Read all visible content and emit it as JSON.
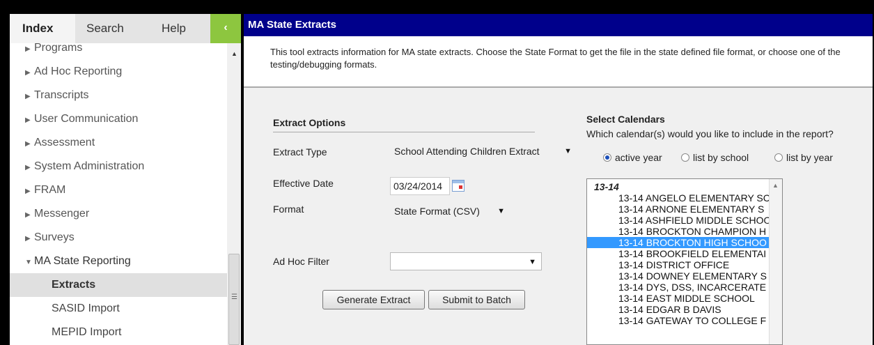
{
  "tabs": {
    "index": "Index",
    "search": "Search",
    "help": "Help",
    "collapse": "‹"
  },
  "nav": {
    "items": [
      {
        "label": "Programs"
      },
      {
        "label": "Ad Hoc Reporting"
      },
      {
        "label": "Transcripts"
      },
      {
        "label": "User Communication"
      },
      {
        "label": "Assessment"
      },
      {
        "label": "System Administration"
      },
      {
        "label": "FRAM"
      },
      {
        "label": "Messenger"
      },
      {
        "label": "Surveys"
      },
      {
        "label": "MA State Reporting"
      }
    ],
    "sub_items": [
      {
        "label": "Extracts"
      },
      {
        "label": "SASID Import"
      },
      {
        "label": "MEPID Import"
      }
    ]
  },
  "main": {
    "title": "MA State Extracts",
    "description": "This tool extracts information for MA state extracts. Choose the State Format to get the file in the state defined file format, or choose one of the testing/debugging formats.",
    "extract_options": {
      "heading": "Extract Options",
      "extract_type_label": "Extract Type",
      "extract_type_value": "School Attending Children Extract",
      "effective_date_label": "Effective Date",
      "effective_date_value": "03/24/2014",
      "format_label": "Format",
      "format_value": "State Format (CSV)",
      "ad_hoc_filter_label": "Ad Hoc Filter",
      "ad_hoc_filter_value": "",
      "generate_button": "Generate Extract",
      "batch_button": "Submit to Batch"
    },
    "calendars": {
      "heading": "Select Calendars",
      "question": "Which calendar(s) would you like to include in the report?",
      "radio_active": "active year",
      "radio_school": "list by school",
      "radio_year": "list by year",
      "group": "13-14",
      "items": [
        "13-14 ANGELO ELEMENTARY SC",
        "13-14 ARNONE ELEMENTARY S",
        "13-14 ASHFIELD MIDDLE SCHOO",
        "13-14 BROCKTON CHAMPION H",
        "13-14 BROCKTON HIGH SCHOO",
        "13-14 BROOKFIELD ELEMENTAI",
        "13-14 DISTRICT OFFICE",
        "13-14 DOWNEY ELEMENTARY S",
        "13-14 DYS, DSS, INCARCERATE",
        "13-14 EAST MIDDLE SCHOOL",
        "13-14 EDGAR B DAVIS",
        "13-14 GATEWAY TO COLLEGE F"
      ]
    }
  }
}
